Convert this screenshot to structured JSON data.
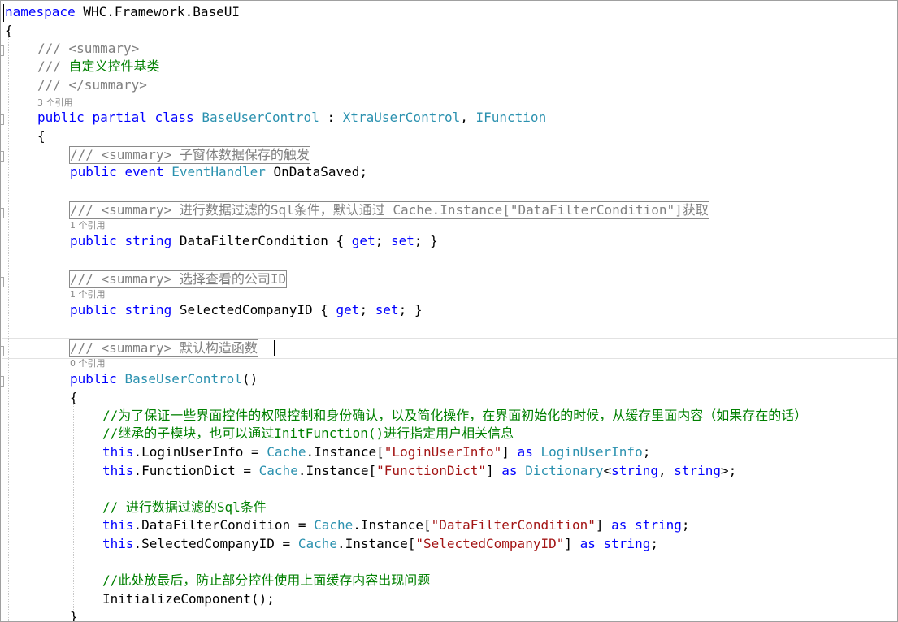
{
  "colors": {
    "keyword": "#0000ff",
    "type": "#2b91af",
    "comment": "#008000",
    "doc": "#808080",
    "string": "#a31515",
    "text": "#000000",
    "codelens": "#8a8a8a"
  },
  "lines": [
    {
      "name": "namespace-line",
      "indent": 0,
      "tokens": [
        {
          "t": "namespace",
          "c": "keyword"
        },
        {
          "t": " WHC.Framework.BaseUI",
          "c": "text"
        }
      ]
    },
    {
      "name": "namespace-open-brace",
      "indent": 0,
      "tokens": [
        {
          "t": "{",
          "c": "text"
        }
      ]
    },
    {
      "name": "summary-open-line",
      "indent": 1,
      "tokens": [
        {
          "t": "/// <summary>",
          "c": "doc"
        }
      ]
    },
    {
      "name": "summary-text-line",
      "indent": 1,
      "tokens": [
        {
          "t": "/// ",
          "c": "doc"
        },
        {
          "t": "自定义控件基类",
          "c": "comment"
        }
      ]
    },
    {
      "name": "summary-close-line",
      "indent": 1,
      "tokens": [
        {
          "t": "/// </summary>",
          "c": "doc"
        }
      ]
    },
    {
      "name": "codelens-class",
      "indent": 1,
      "lens": true,
      "tokens": [
        {
          "t": "3 个引用",
          "c": "codelens"
        }
      ]
    },
    {
      "name": "class-declaration-line",
      "indent": 1,
      "tokens": [
        {
          "t": "public",
          "c": "keyword"
        },
        {
          "t": " ",
          "c": "text"
        },
        {
          "t": "partial",
          "c": "keyword"
        },
        {
          "t": " ",
          "c": "text"
        },
        {
          "t": "class",
          "c": "keyword"
        },
        {
          "t": " ",
          "c": "text"
        },
        {
          "t": "BaseUserControl",
          "c": "type"
        },
        {
          "t": " : ",
          "c": "text"
        },
        {
          "t": "XtraUserControl",
          "c": "type"
        },
        {
          "t": ", ",
          "c": "text"
        },
        {
          "t": "IFunction",
          "c": "type"
        }
      ]
    },
    {
      "name": "class-open-brace",
      "indent": 1,
      "tokens": [
        {
          "t": "{",
          "c": "text"
        }
      ]
    },
    {
      "name": "collapsed-summary-ondatasaved",
      "indent": 2,
      "boxed": true,
      "tokens": [
        {
          "t": "/// <summary> 子窗体数据保存的触发",
          "c": "doc"
        }
      ]
    },
    {
      "name": "event-declaration-line",
      "indent": 2,
      "tokens": [
        {
          "t": "public",
          "c": "keyword"
        },
        {
          "t": " ",
          "c": "text"
        },
        {
          "t": "event",
          "c": "keyword"
        },
        {
          "t": " ",
          "c": "text"
        },
        {
          "t": "EventHandler",
          "c": "type"
        },
        {
          "t": " OnDataSaved;",
          "c": "text"
        }
      ]
    },
    {
      "name": "collapsed-summary-datafilter",
      "indent": 2,
      "boxed": true,
      "tokens": [
        {
          "t": "/// <summary> 进行数据过滤的Sql条件，默认通过 Cache.Instance[\"DataFilterCondition\"]获取",
          "c": "doc"
        }
      ]
    },
    {
      "name": "codelens-datafilter",
      "indent": 2,
      "lens": true,
      "tokens": [
        {
          "t": "1 个引用",
          "c": "codelens"
        }
      ]
    },
    {
      "name": "datafilter-property-line",
      "indent": 2,
      "tokens": [
        {
          "t": "public",
          "c": "keyword"
        },
        {
          "t": " ",
          "c": "text"
        },
        {
          "t": "string",
          "c": "keyword"
        },
        {
          "t": " DataFilterCondition { ",
          "c": "text"
        },
        {
          "t": "get",
          "c": "keyword"
        },
        {
          "t": "; ",
          "c": "text"
        },
        {
          "t": "set",
          "c": "keyword"
        },
        {
          "t": "; }",
          "c": "text"
        }
      ]
    },
    {
      "name": "collapsed-summary-company",
      "indent": 2,
      "boxed": true,
      "tokens": [
        {
          "t": "/// <summary> 选择查看的公司ID",
          "c": "doc"
        }
      ]
    },
    {
      "name": "codelens-company",
      "indent": 2,
      "lens": true,
      "tokens": [
        {
          "t": "1 个引用",
          "c": "codelens"
        }
      ]
    },
    {
      "name": "company-property-line",
      "indent": 2,
      "tokens": [
        {
          "t": "public",
          "c": "keyword"
        },
        {
          "t": " ",
          "c": "text"
        },
        {
          "t": "string",
          "c": "keyword"
        },
        {
          "t": " SelectedCompanyID { ",
          "c": "text"
        },
        {
          "t": "get",
          "c": "keyword"
        },
        {
          "t": "; ",
          "c": "text"
        },
        {
          "t": "set",
          "c": "keyword"
        },
        {
          "t": "; }",
          "c": "text"
        }
      ]
    },
    {
      "name": "collapsed-summary-ctor",
      "indent": 2,
      "boxed": true,
      "tokens": [
        {
          "t": "/// <summary> 默认构造函数",
          "c": "doc"
        }
      ]
    },
    {
      "name": "codelens-ctor",
      "indent": 2,
      "lens": true,
      "tokens": [
        {
          "t": "0 个引用",
          "c": "codelens"
        }
      ]
    },
    {
      "name": "constructor-line",
      "indent": 2,
      "tokens": [
        {
          "t": "public",
          "c": "keyword"
        },
        {
          "t": " ",
          "c": "text"
        },
        {
          "t": "BaseUserControl",
          "c": "type"
        },
        {
          "t": "()",
          "c": "text"
        }
      ]
    },
    {
      "name": "ctor-open-brace",
      "indent": 2,
      "tokens": [
        {
          "t": "{",
          "c": "text"
        }
      ]
    },
    {
      "name": "comment-line-1",
      "indent": 3,
      "tokens": [
        {
          "t": "//为了保证一些界面控件的权限控制和身份确认，以及简化操作，在界面初始化的时候，从缓存里面内容（如果存在的话）",
          "c": "comment"
        }
      ]
    },
    {
      "name": "comment-line-2",
      "indent": 3,
      "tokens": [
        {
          "t": "//继承的子模块，也可以通过InitFunction()进行指定用户相关信息",
          "c": "comment"
        }
      ]
    },
    {
      "name": "loginuserinfo-line",
      "indent": 3,
      "tokens": [
        {
          "t": "this",
          "c": "keyword"
        },
        {
          "t": ".LoginUserInfo = ",
          "c": "text"
        },
        {
          "t": "Cache",
          "c": "type"
        },
        {
          "t": ".Instance[",
          "c": "text"
        },
        {
          "t": "\"LoginUserInfo\"",
          "c": "string"
        },
        {
          "t": "] ",
          "c": "text"
        },
        {
          "t": "as",
          "c": "keyword"
        },
        {
          "t": " ",
          "c": "text"
        },
        {
          "t": "LoginUserInfo",
          "c": "type"
        },
        {
          "t": ";",
          "c": "text"
        }
      ]
    },
    {
      "name": "functiondict-line",
      "indent": 3,
      "tokens": [
        {
          "t": "this",
          "c": "keyword"
        },
        {
          "t": ".FunctionDict = ",
          "c": "text"
        },
        {
          "t": "Cache",
          "c": "type"
        },
        {
          "t": ".Instance[",
          "c": "text"
        },
        {
          "t": "\"FunctionDict\"",
          "c": "string"
        },
        {
          "t": "] ",
          "c": "text"
        },
        {
          "t": "as",
          "c": "keyword"
        },
        {
          "t": " ",
          "c": "text"
        },
        {
          "t": "Dictionary",
          "c": "type"
        },
        {
          "t": "<",
          "c": "text"
        },
        {
          "t": "string",
          "c": "keyword"
        },
        {
          "t": ", ",
          "c": "text"
        },
        {
          "t": "string",
          "c": "keyword"
        },
        {
          "t": ">;",
          "c": "text"
        }
      ]
    },
    {
      "name": "comment-line-3",
      "indent": 3,
      "tokens": [
        {
          "t": "// 进行数据过滤的Sql条件",
          "c": "comment"
        }
      ]
    },
    {
      "name": "datafilter-assign-line",
      "indent": 3,
      "tokens": [
        {
          "t": "this",
          "c": "keyword"
        },
        {
          "t": ".DataFilterCondition = ",
          "c": "text"
        },
        {
          "t": "Cache",
          "c": "type"
        },
        {
          "t": ".Instance[",
          "c": "text"
        },
        {
          "t": "\"DataFilterCondition\"",
          "c": "string"
        },
        {
          "t": "] ",
          "c": "text"
        },
        {
          "t": "as",
          "c": "keyword"
        },
        {
          "t": " ",
          "c": "text"
        },
        {
          "t": "string",
          "c": "keyword"
        },
        {
          "t": ";",
          "c": "text"
        }
      ]
    },
    {
      "name": "company-assign-line",
      "indent": 3,
      "tokens": [
        {
          "t": "this",
          "c": "keyword"
        },
        {
          "t": ".SelectedCompanyID = ",
          "c": "text"
        },
        {
          "t": "Cache",
          "c": "type"
        },
        {
          "t": ".Instance[",
          "c": "text"
        },
        {
          "t": "\"SelectedCompanyID\"",
          "c": "string"
        },
        {
          "t": "] ",
          "c": "text"
        },
        {
          "t": "as",
          "c": "keyword"
        },
        {
          "t": " ",
          "c": "text"
        },
        {
          "t": "string",
          "c": "keyword"
        },
        {
          "t": ";",
          "c": "text"
        }
      ]
    },
    {
      "name": "comment-line-4",
      "indent": 3,
      "tokens": [
        {
          "t": "//此处放最后，防止部分控件使用上面缓存内容出现问题",
          "c": "comment"
        }
      ]
    },
    {
      "name": "initialize-component-line",
      "indent": 3,
      "tokens": [
        {
          "t": "InitializeComponent();",
          "c": "text"
        }
      ]
    },
    {
      "name": "ctor-close-brace",
      "indent": 2,
      "tokens": [
        {
          "t": "}",
          "c": "text"
        }
      ]
    }
  ]
}
